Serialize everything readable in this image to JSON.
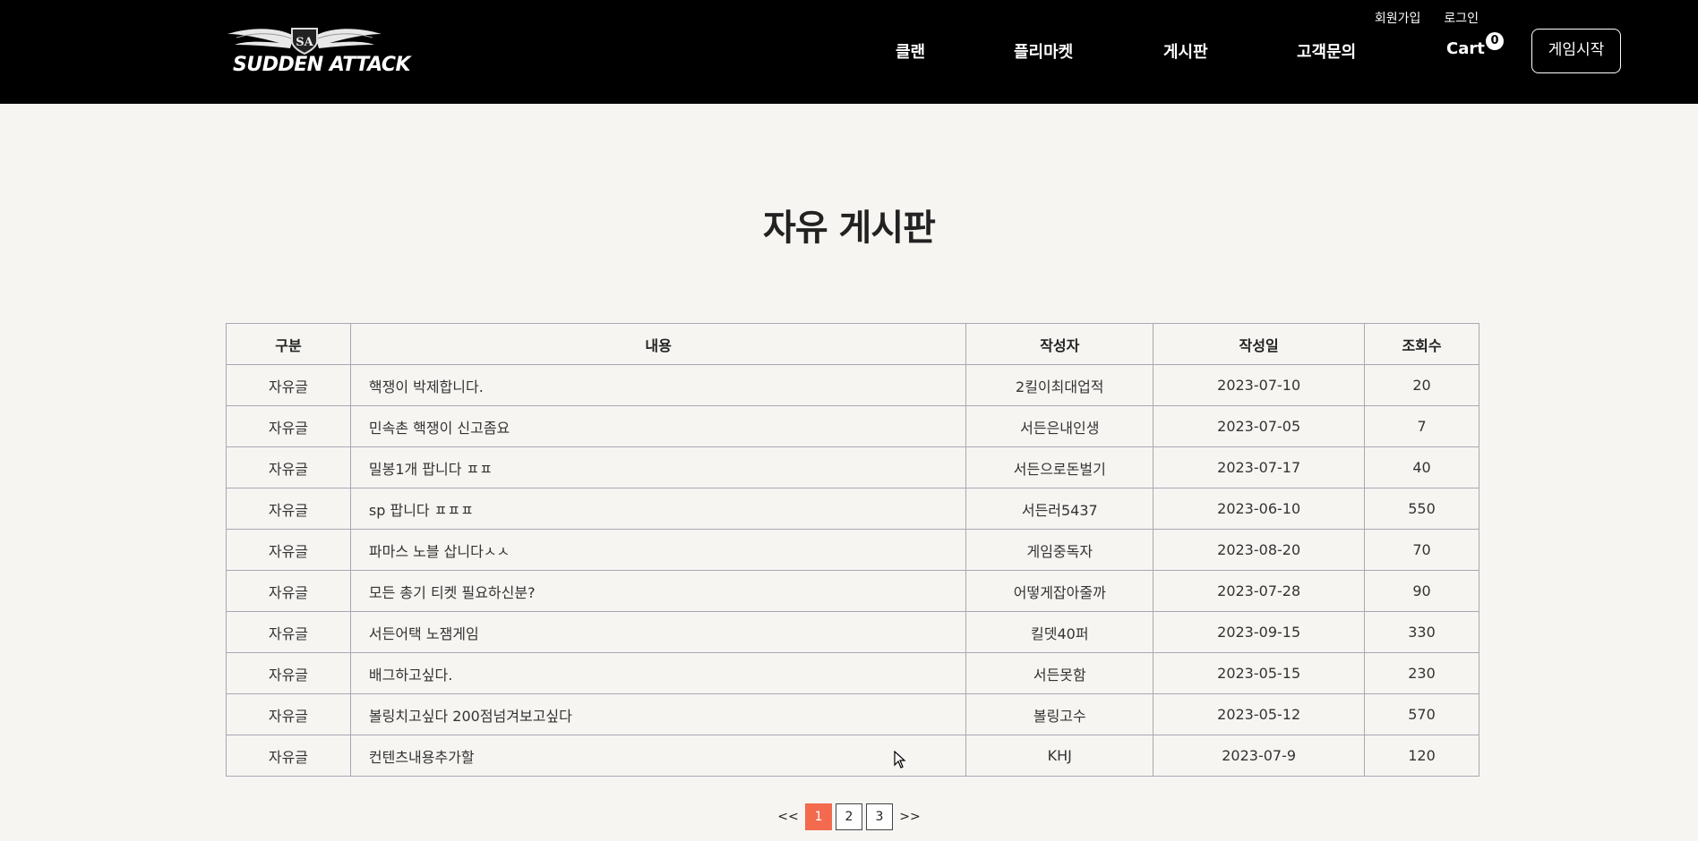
{
  "header": {
    "logo_text": "SUDDEN ATTACK",
    "util": {
      "signup": "회원가입",
      "login": "로그인"
    },
    "nav": [
      {
        "label": "클랜"
      },
      {
        "label": "플리마켓"
      },
      {
        "label": "게시판"
      },
      {
        "label": "고객문의"
      }
    ],
    "cart": {
      "label": "Cart",
      "count": "0"
    },
    "game_start": "게임시작"
  },
  "page": {
    "title": "자유 게시판"
  },
  "table": {
    "headers": [
      "구분",
      "내용",
      "작성자",
      "작성일",
      "조회수"
    ],
    "rows": [
      {
        "category": "자유글",
        "content": "핵쟁이 박제합니다.",
        "author": "2킬이최대업적",
        "date": "2023-07-10",
        "views": "20"
      },
      {
        "category": "자유글",
        "content": "민속촌 핵쟁이 신고좀요",
        "author": "서든은내인생",
        "date": "2023-07-05",
        "views": "7"
      },
      {
        "category": "자유글",
        "content": "밀봉1개 팝니다 ㅍㅍ",
        "author": "서든으로돈벌기",
        "date": "2023-07-17",
        "views": "40"
      },
      {
        "category": "자유글",
        "content": "sp 팝니다 ㅍㅍㅍ",
        "author": "서든러5437",
        "date": "2023-06-10",
        "views": "550"
      },
      {
        "category": "자유글",
        "content": "파마스 노블 삽니다ㅅㅅ",
        "author": "게임중독자",
        "date": "2023-08-20",
        "views": "70"
      },
      {
        "category": "자유글",
        "content": "모든 총기 티켓 필요하신분?",
        "author": "어떻게잡아줄까",
        "date": "2023-07-28",
        "views": "90"
      },
      {
        "category": "자유글",
        "content": "서든어택 노잼게임",
        "author": "킬뎃40퍼",
        "date": "2023-09-15",
        "views": "330"
      },
      {
        "category": "자유글",
        "content": "배그하고싶다.",
        "author": "서든못함",
        "date": "2023-05-15",
        "views": "230"
      },
      {
        "category": "자유글",
        "content": "볼링치고싶다 200점넘겨보고싶다",
        "author": "볼링고수",
        "date": "2023-05-12",
        "views": "570"
      },
      {
        "category": "자유글",
        "content": "컨텐츠내용추가할",
        "author": "KHJ",
        "date": "2023-07-9",
        "views": "120"
      }
    ]
  },
  "pagination": {
    "prev": "<<",
    "pages": [
      "1",
      "2",
      "3"
    ],
    "current": "1",
    "next": ">>"
  },
  "colors": {
    "header_bg": "#000000",
    "accent": "#f36a4f",
    "page_bg": "#f6f5f2"
  }
}
